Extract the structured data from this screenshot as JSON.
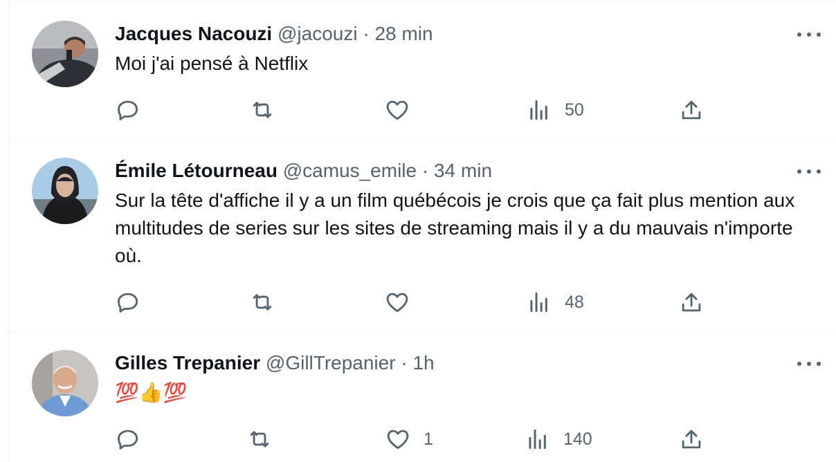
{
  "tweets": [
    {
      "name": "Jacques Nacouzi",
      "handle": "@jacouzi",
      "separator": "·",
      "time": "28 min",
      "text": "Moi j'ai pensé à Netflix",
      "replies": "",
      "retweets": "",
      "likes": "",
      "views": "50"
    },
    {
      "name": "Émile Létourneau",
      "handle": "@camus_emile",
      "separator": "·",
      "time": "34 min",
      "text": "Sur la tête d'affiche il y a un film québécois je crois que ça fait plus mention aux multitudes de series sur les sites de streaming mais il y a du mauvais n'importe où.",
      "replies": "",
      "retweets": "",
      "likes": "",
      "views": "48"
    },
    {
      "name": "Gilles Trepanier",
      "handle": "@GillTrepanier",
      "separator": "·",
      "time": "1h",
      "text": "💯👍💯",
      "replies": "",
      "retweets": "",
      "likes": "1",
      "views": "140"
    }
  ],
  "icons": {
    "reply": "reply-icon",
    "retweet": "retweet-icon",
    "like": "heart-icon",
    "views": "views-icon",
    "share": "share-icon",
    "more": "more-icon"
  },
  "colors": {
    "text": "#0f1419",
    "secondary": "#536471",
    "border": "#eff3f4"
  }
}
